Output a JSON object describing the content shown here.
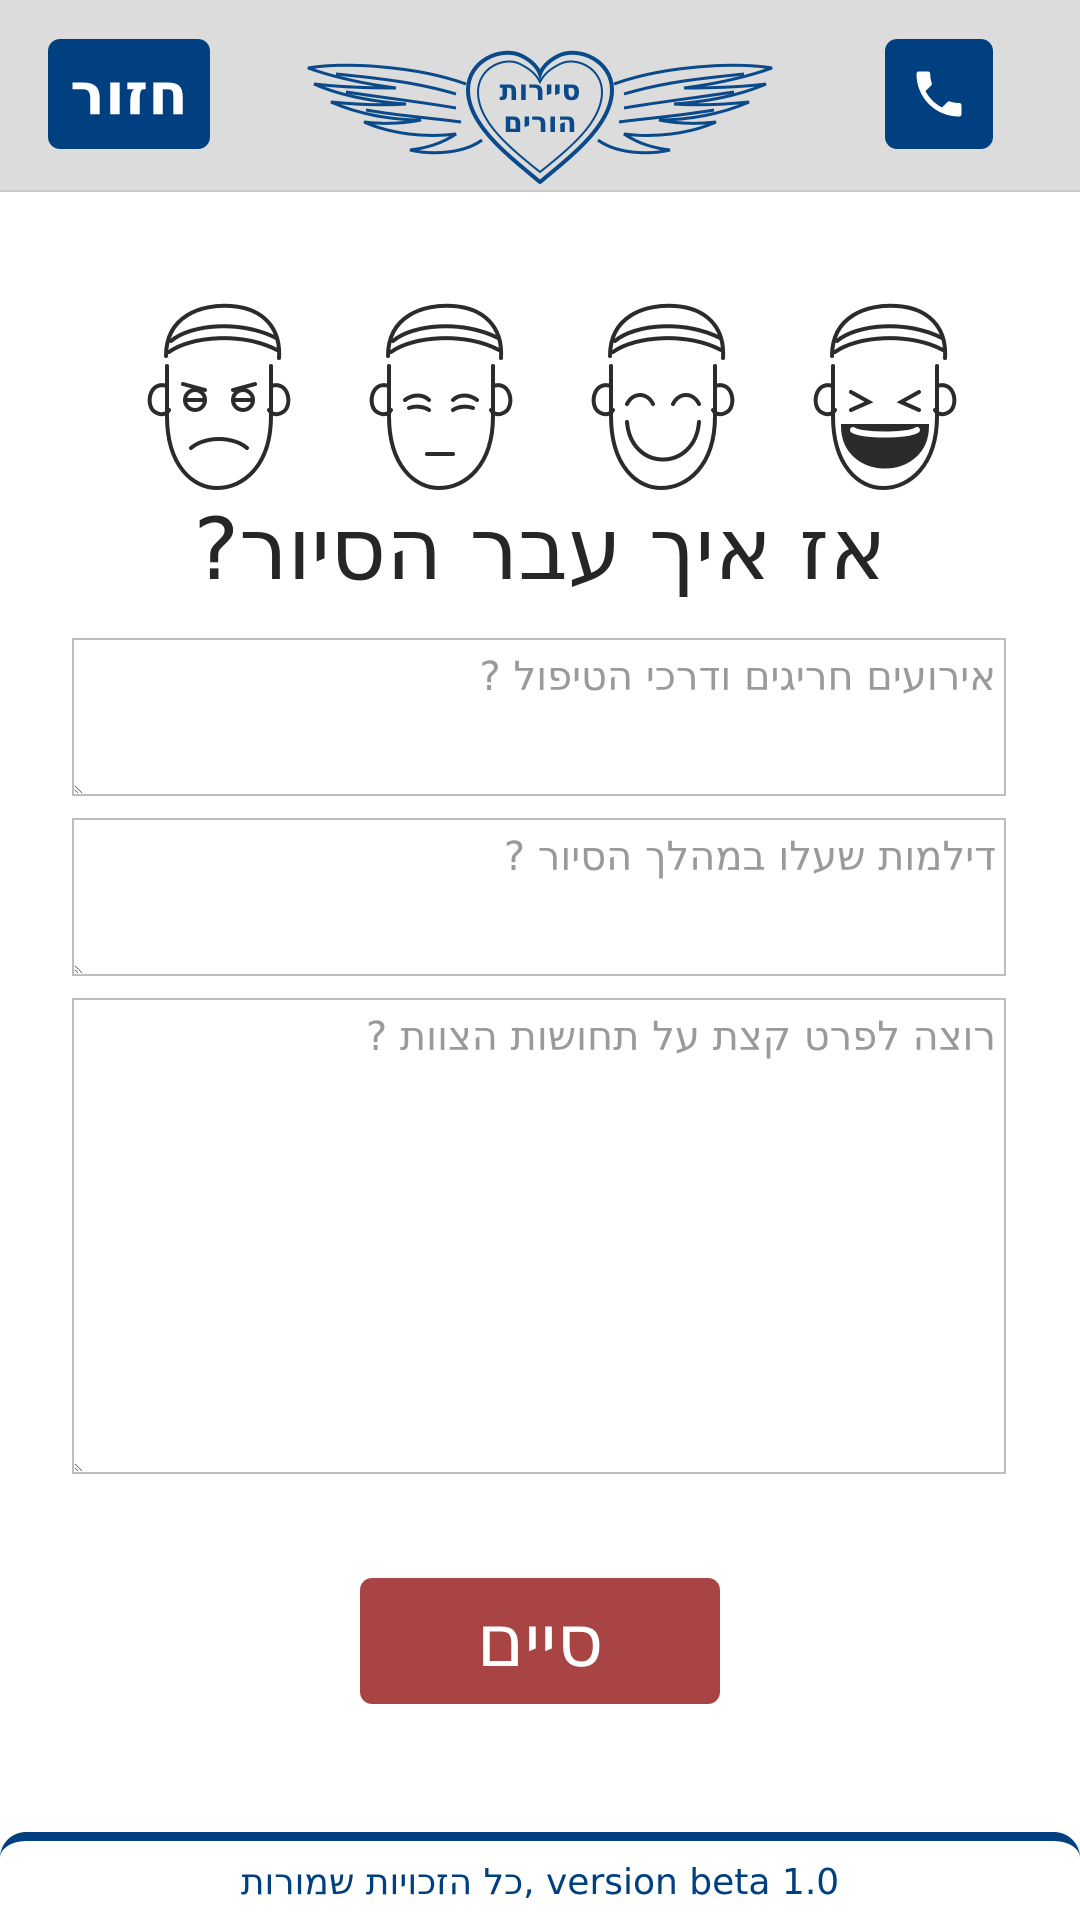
{
  "header": {
    "back_label": "חזור",
    "logo_text_line1": "סיירות",
    "logo_text_line2": "הורים",
    "phone_icon": "phone-icon"
  },
  "faces": [
    {
      "name": "angry",
      "icon": "angry-face-icon"
    },
    {
      "name": "sad",
      "icon": "sad-face-icon"
    },
    {
      "name": "smile",
      "icon": "smiling-face-icon"
    },
    {
      "name": "laugh",
      "icon": "laughing-face-icon"
    }
  ],
  "form": {
    "title": "אז איך עבר הסיור?",
    "field1_placeholder": "אירועים חריגים ודרכי הטיפול ?",
    "field2_placeholder": "דילמות שעלו במהלך הסיור ?",
    "field3_placeholder": "רוצה לפרט קצת על תחושות הצוות ?",
    "submit_label": "סיים"
  },
  "footer": {
    "text": "כל הזכויות שמורות, version beta 1.0"
  },
  "colors": {
    "primary": "#004080",
    "submit": "#a84444",
    "header_bg": "#dcdcdc"
  }
}
